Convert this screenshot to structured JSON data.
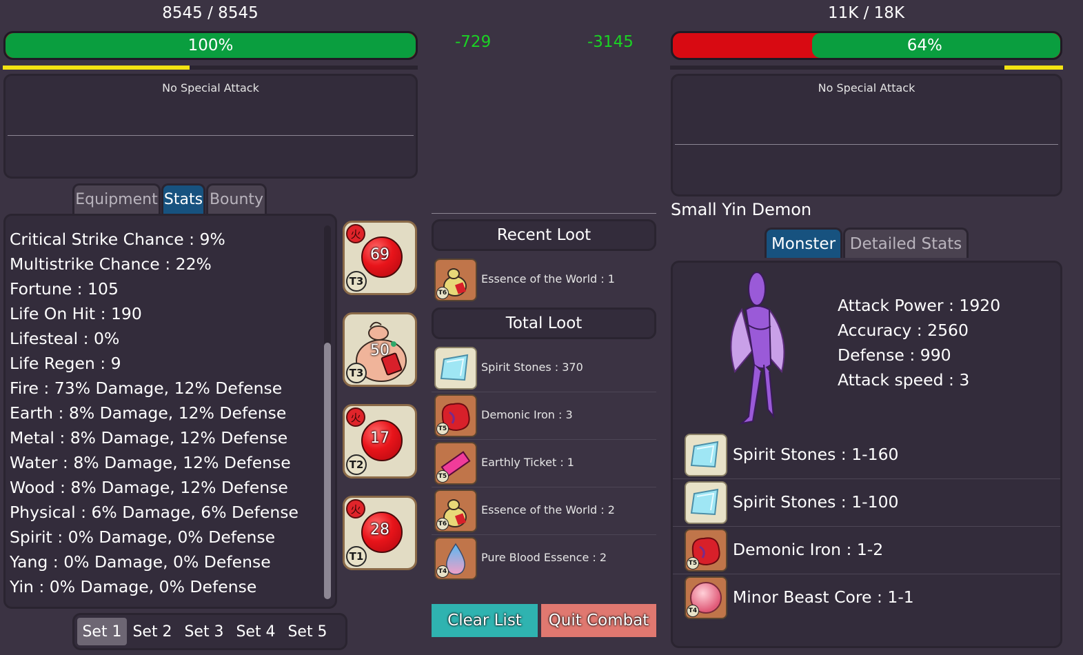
{
  "player": {
    "hp_text": "8545 / 8545",
    "hp_percent_label": "100%",
    "hp_fraction": 1.0,
    "attack_timer_fraction": 0.45,
    "special_attack": "No Special Attack"
  },
  "enemy": {
    "hp_text": "11K / 18K",
    "hp_percent_label": "64%",
    "hp_fraction": 0.64,
    "attack_timer_fraction": 0.15,
    "special_attack": "No Special Attack",
    "name": "Small Yin Demon"
  },
  "damage_numbers": [
    "-729",
    "-3145"
  ],
  "player_tabs": [
    {
      "label": "Equipment",
      "active": false
    },
    {
      "label": "Stats",
      "active": true
    },
    {
      "label": "Bounty",
      "active": false
    }
  ],
  "stats": [
    "Critical Strike Chance : 9%",
    "Multistrike Chance : 22%",
    "Fortune : 105",
    "Life On Hit : 190",
    "Lifesteal : 0%",
    "Life Regen : 9",
    "Fire : 73% Damage, 12% Defense",
    "Earth : 8% Damage, 12% Defense",
    "Metal : 8% Damage, 12% Defense",
    "Water : 8% Damage, 12% Defense",
    "Wood : 8% Damage, 12% Defense",
    "Physical : 6% Damage, 6% Defense",
    "Spirit : 0% Damage, 0% Defense",
    "Yang : 0% Damage, 0% Defense",
    "Yin : 0% Damage, 0% Defense"
  ],
  "skills": [
    {
      "number": "69",
      "tier": "T3",
      "element": "火",
      "icon": "fire-orb-icon"
    },
    {
      "number": "50",
      "tier": "T3",
      "element": "",
      "icon": "gourd-pouch-icon"
    },
    {
      "number": "17",
      "tier": "T2",
      "element": "火",
      "icon": "fire-orb-icon"
    },
    {
      "number": "28",
      "tier": "T1",
      "element": "火",
      "icon": "fire-orb-icon"
    }
  ],
  "equipment_sets": [
    {
      "label": "Set 1",
      "active": true
    },
    {
      "label": "Set 2",
      "active": false
    },
    {
      "label": "Set 3",
      "active": false
    },
    {
      "label": "Set 4",
      "active": false
    },
    {
      "label": "Set 5",
      "active": false
    }
  ],
  "recent_loot": {
    "title": "Recent Loot",
    "items": [
      {
        "name": "Essence of the World : 1",
        "tier": "T6",
        "icon": "gourd-icon"
      }
    ]
  },
  "total_loot": {
    "title": "Total Loot",
    "items": [
      {
        "name": "Spirit Stones : 370",
        "tier": "",
        "icon": "spirit-stone-icon"
      },
      {
        "name": "Demonic Iron : 3",
        "tier": "T5",
        "icon": "demonic-iron-icon"
      },
      {
        "name": "Earthly Ticket : 1",
        "tier": "T5",
        "icon": "ticket-icon"
      },
      {
        "name": "Essence of the World : 2",
        "tier": "T6",
        "icon": "gourd-icon"
      },
      {
        "name": "Pure Blood Essence : 2",
        "tier": "T4",
        "icon": "blood-drop-icon"
      }
    ]
  },
  "buttons": {
    "clear_list": "Clear List",
    "quit_combat": "Quit Combat"
  },
  "monster_tabs": [
    {
      "label": "Monster",
      "active": true
    },
    {
      "label": "Detailed Stats",
      "active": false
    }
  ],
  "monster_stats": [
    "Attack Power : 1920",
    "Accuracy : 2560",
    "Defense : 990",
    "Attack speed : 3"
  ],
  "monster_drops": [
    {
      "name": "Spirit Stones : 1-160",
      "tier": "",
      "icon": "spirit-stone-icon"
    },
    {
      "name": "Spirit Stones : 1-100",
      "tier": "",
      "icon": "spirit-stone-icon"
    },
    {
      "name": "Demonic Iron : 1-2",
      "tier": "T5",
      "icon": "demonic-iron-icon"
    },
    {
      "name": "Minor Beast Core : 1-1",
      "tier": "T4",
      "icon": "beast-core-icon"
    }
  ],
  "colors": {
    "hp_green": "#0a9e3f",
    "hp_red": "#d80a12",
    "timer_yellow": "#f3e312",
    "damage_green": "#1bd224",
    "tab_active": "#17527f",
    "clear_button": "#2fb3b0",
    "quit_button": "#e07870"
  }
}
